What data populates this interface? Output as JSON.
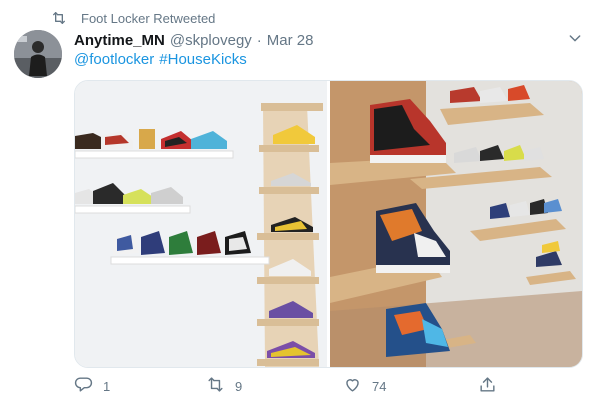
{
  "retweet_line": {
    "text": "Foot Locker Retweeted"
  },
  "tweet": {
    "display_name": "Anytime_MN",
    "handle": "@skplovegy",
    "separator": "·",
    "date": "Mar 28",
    "mentions": [
      "@footlocker",
      "#HouseKicks"
    ]
  },
  "actions": {
    "reply_count": "1",
    "retweet_count": "9",
    "like_count": "74"
  },
  "colors": {
    "link": "#1b95e0",
    "muted": "#657786",
    "text": "#14171a"
  },
  "icons": [
    "retweet-icon",
    "chevron-down-icon",
    "reply-icon",
    "like-icon",
    "share-icon"
  ]
}
